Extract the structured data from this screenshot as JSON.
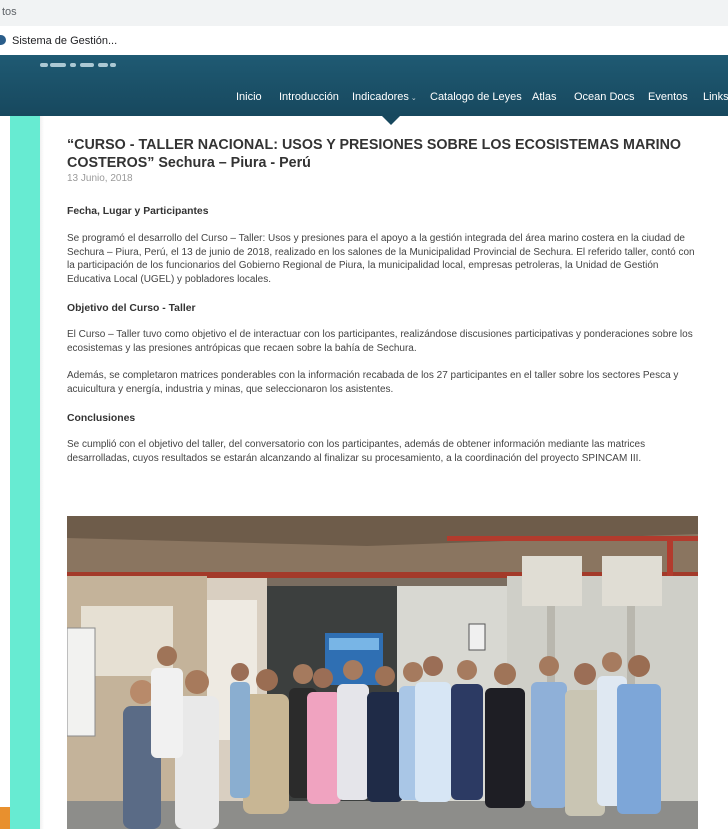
{
  "browser": {
    "tab_fragment": "tos",
    "bookmark_label": "Sistema de Gestión..."
  },
  "nav": {
    "items": [
      "Inicio",
      "Introducción",
      "Indicadores",
      "Catalogo de Leyes",
      "Atlas",
      "Ocean Docs",
      "Eventos",
      "Links"
    ]
  },
  "article": {
    "title": "“CURSO - TALLER NACIONAL: USOS Y PRESIONES SOBRE LOS ECOSISTEMAS MARINO COSTEROS” Sechura – Piura - Perú",
    "date": "13 Junio, 2018",
    "sections": [
      {
        "heading": "Fecha, Lugar y Participantes",
        "paragraphs": [
          "Se programó el desarrollo del Curso – Taller: Usos y presiones para el apoyo a la gestión integrada del área marino costera en la ciudad de Sechura – Piura, Perú, el 13 de junio de 2018, realizado en los salones de la Municipalidad Provincial de Sechura. El referido taller, contó con la participación de los funcionarios del Gobierno Regional de Piura, la municipalidad local, empresas petroleras, la Unidad de Gestión Educativa Local (UGEL) y pobladores locales."
        ]
      },
      {
        "heading": "Objetivo del Curso - Taller",
        "paragraphs": [
          "El Curso – Taller tuvo como objetivo el de interactuar con los participantes, realizándose discusiones participativas y ponderaciones sobre los ecosistemas y las presiones antrópicas que recaen sobre la bahía de Sechura.",
          "Además, se completaron matrices ponderables con la información recabada de los 27 participantes en el taller sobre los sectores Pesca y acuicultura y energía, industria y minas, que seleccionaron los asistentes."
        ]
      },
      {
        "heading": "Conclusiones",
        "paragraphs": [
          "Se cumplió con el objetivo del taller, del conversatorio con los participantes, además de obtener información mediante las matrices desarrolladas, cuyos resultados se estarán alcanzando al finalizar su procesamiento, a la coordinación del proyecto SPINCAM III."
        ]
      }
    ]
  },
  "colors": {
    "header": "#1f5a73",
    "stripe": "#67ebd2",
    "accent_tab": "#e8902e"
  },
  "icons": {
    "bookmark": "site-favicon-icon",
    "dropdown": "chevron-down-icon"
  }
}
